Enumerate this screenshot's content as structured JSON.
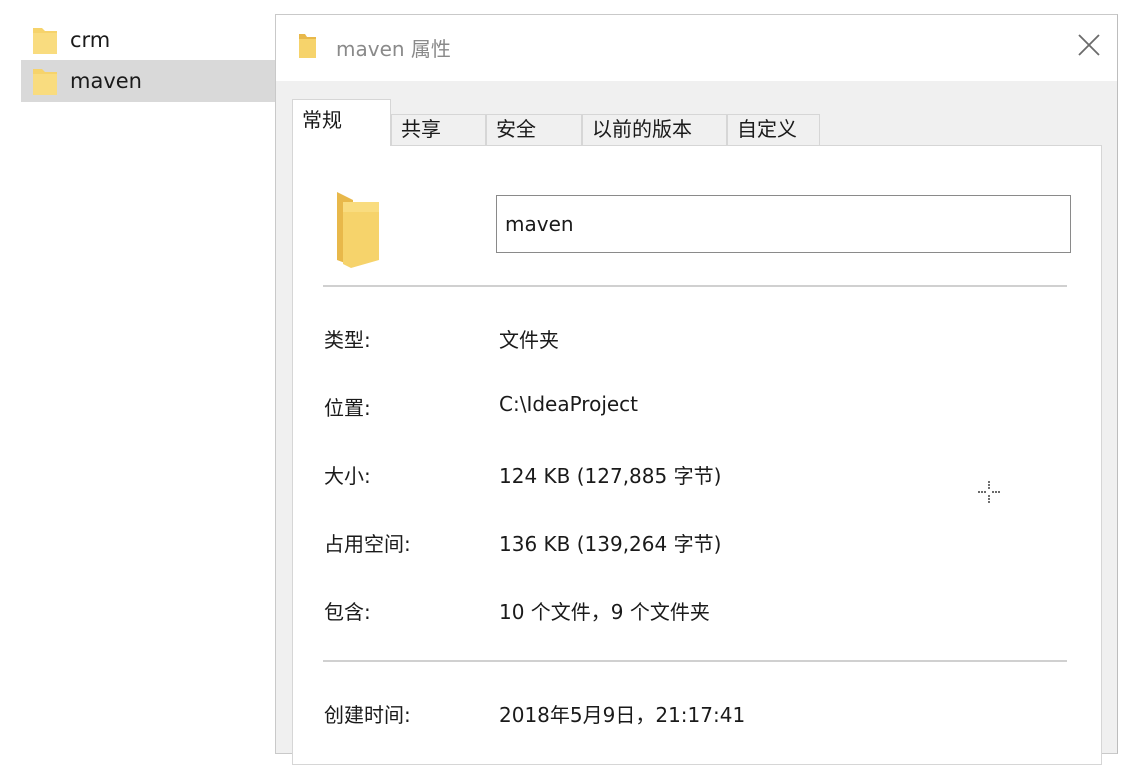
{
  "explorer": {
    "items": [
      {
        "label": "crm",
        "icon": "folder-icon",
        "selected": false
      },
      {
        "label": "maven",
        "icon": "folder-icon",
        "selected": true
      }
    ]
  },
  "dialog": {
    "title": "maven 属性",
    "close_icon": "close-icon",
    "tabs": [
      {
        "label": "常规",
        "active": true
      },
      {
        "label": "共享",
        "active": false
      },
      {
        "label": "安全",
        "active": false
      },
      {
        "label": "以前的版本",
        "active": false
      },
      {
        "label": "自定义",
        "active": false
      }
    ],
    "general": {
      "name_value": "maven",
      "properties": [
        {
          "label": "类型:",
          "value": "文件夹"
        },
        {
          "label": "位置:",
          "value": "C:\\IdeaProject"
        },
        {
          "label": "大小:",
          "value": "124 KB (127,885 字节)"
        },
        {
          "label": "占用空间:",
          "value": "136 KB (139,264 字节)"
        },
        {
          "label": "包含:",
          "value": "10 个文件，9 个文件夹"
        },
        {
          "label": "创建时间:",
          "value": "2018年5月9日，21:17:41"
        }
      ]
    }
  },
  "colors": {
    "folder_fill": "#f6d36b",
    "folder_shade": "#e8b84a",
    "selection": "#d9d9d9"
  }
}
